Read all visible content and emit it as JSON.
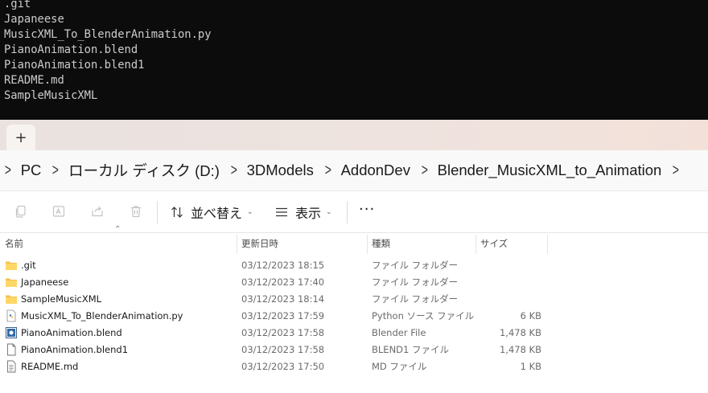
{
  "terminal": {
    "lines": [
      ".git",
      "Japaneese",
      "MusicXML_To_BlenderAnimation.py",
      "PianoAnimation.blend",
      "PianoAnimation.blend1",
      "README.md",
      "SampleMusicXML"
    ]
  },
  "tabbar": {
    "new_tab_label": "+"
  },
  "breadcrumb": {
    "items": [
      "PC",
      "ローカル ディスク (D:)",
      "3DModels",
      "AddonDev",
      "Blender_MusicXML_to_Animation"
    ]
  },
  "toolbar": {
    "sort_label": "並べ替え",
    "view_label": "表示",
    "more_label": "···"
  },
  "columns": {
    "name": "名前",
    "date": "更新日時",
    "type": "種類",
    "size": "サイズ"
  },
  "files": [
    {
      "name": ".git",
      "date": "03/12/2023 18:15",
      "type": "ファイル フォルダー",
      "size": "",
      "icon": "folder-icon"
    },
    {
      "name": "Japaneese",
      "date": "03/12/2023 17:40",
      "type": "ファイル フォルダー",
      "size": "",
      "icon": "folder-icon"
    },
    {
      "name": "SampleMusicXML",
      "date": "03/12/2023 18:14",
      "type": "ファイル フォルダー",
      "size": "",
      "icon": "folder-icon"
    },
    {
      "name": "MusicXML_To_BlenderAnimation.py",
      "date": "03/12/2023 17:59",
      "type": "Python ソース ファイル",
      "size": "6 KB",
      "icon": "python-file-icon"
    },
    {
      "name": "PianoAnimation.blend",
      "date": "03/12/2023 17:58",
      "type": "Blender File",
      "size": "1,478 KB",
      "icon": "blender-file-icon"
    },
    {
      "name": "PianoAnimation.blend1",
      "date": "03/12/2023 17:58",
      "type": "BLEND1 ファイル",
      "size": "1,478 KB",
      "icon": "file-icon"
    },
    {
      "name": "README.md",
      "date": "03/12/2023 17:50",
      "type": "MD ファイル",
      "size": "1 KB",
      "icon": "text-file-icon"
    }
  ],
  "colors": {
    "terminal_bg": "#0c0c0c",
    "terminal_fg": "#cccccc",
    "folder": "#f2c14e"
  }
}
